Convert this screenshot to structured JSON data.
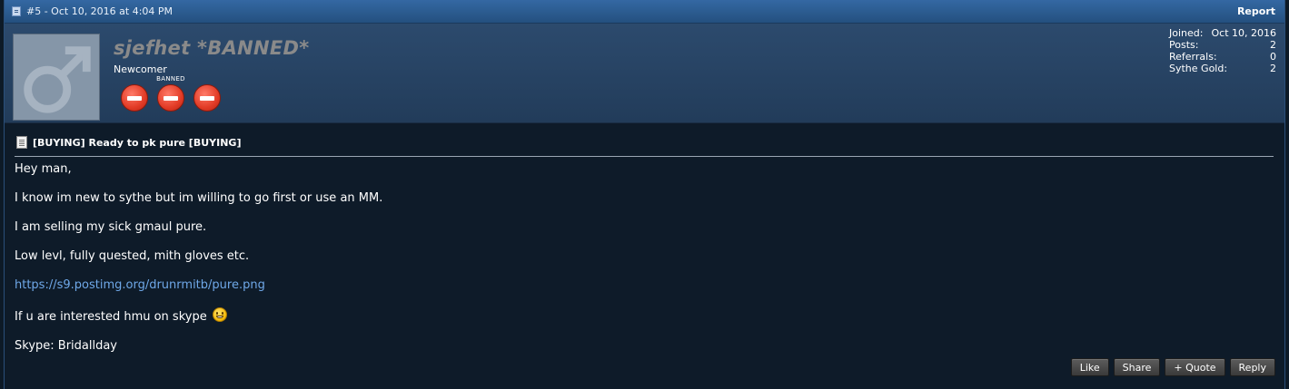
{
  "post": {
    "meta": "#5 - Oct 10, 2016 at 4:04 PM",
    "report_label": "Report"
  },
  "user": {
    "username": "sjefhet *BANNED*",
    "title": "Newcomer",
    "badge_label": "BANNED",
    "stats": [
      {
        "label": "Joined:",
        "value": "Oct 10, 2016"
      },
      {
        "label": "Posts:",
        "value": "2"
      },
      {
        "label": "Referrals:",
        "value": "0"
      },
      {
        "label": "Sythe Gold:",
        "value": "2"
      }
    ]
  },
  "thread_title": "[BUYING] Ready to pk pure [BUYING]",
  "message": {
    "greeting": "Hey man,",
    "line1": "I know im new to sythe but im willing to go first or use an MM.",
    "line2": "I am selling my sick gmaul pure.",
    "line3": "Low levl, fully quested, mith gloves etc.",
    "link": "https://s9.postimg.org/drunrmitb/pure.png",
    "line4": "If u are interested hmu on skype",
    "line5": "Skype: Bridallday"
  },
  "actions": {
    "like": "Like",
    "share": "Share",
    "quote": "+ Quote",
    "reply": "Reply"
  }
}
